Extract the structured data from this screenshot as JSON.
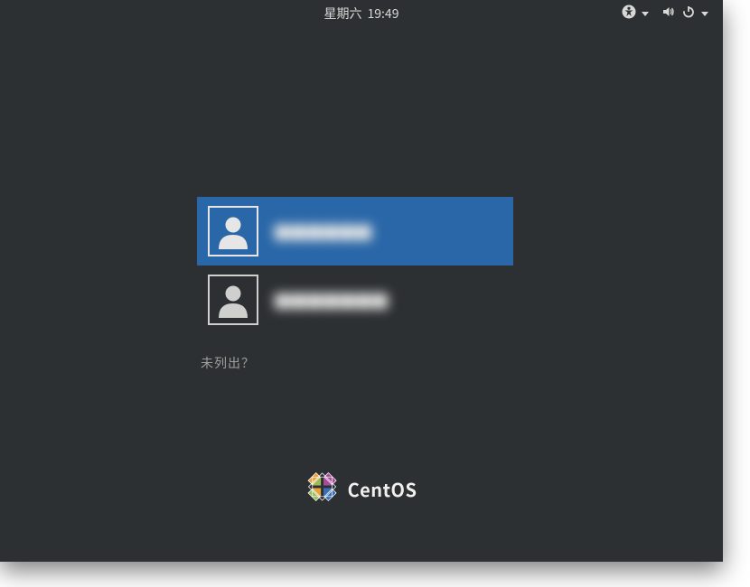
{
  "topbar": {
    "day": "星期六",
    "time": "19:49"
  },
  "users": [
    {
      "name": "██████",
      "selected": true
    },
    {
      "name": "███████",
      "selected": false
    }
  ],
  "not_listed_label": "未列出？",
  "branding": {
    "name": "CentOS"
  },
  "icons": {
    "accessibility": "accessibility-icon",
    "volume": "volume-icon",
    "power": "power-icon"
  }
}
